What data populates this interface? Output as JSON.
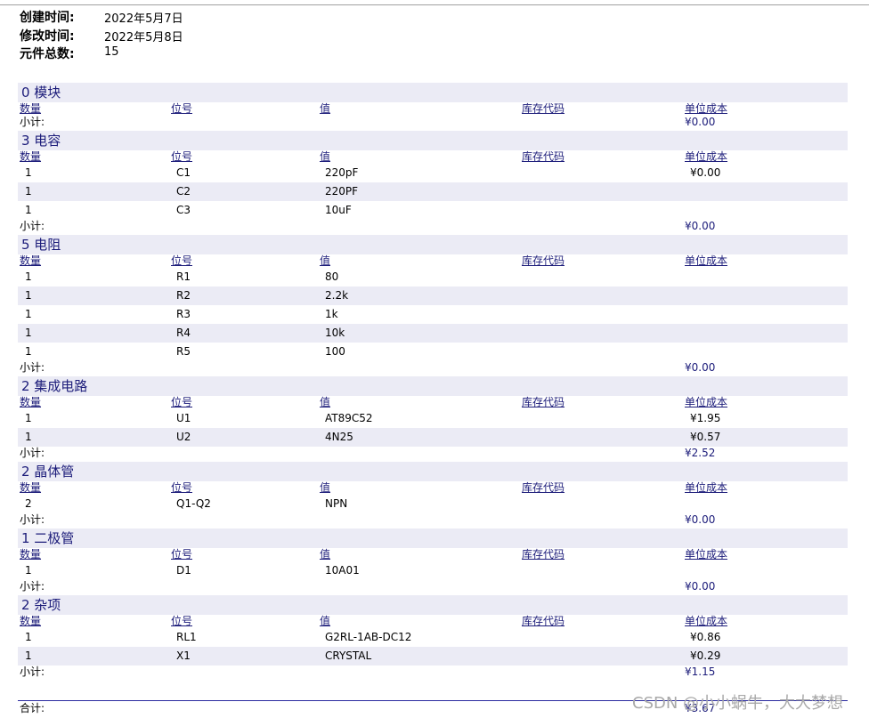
{
  "header": {
    "created_label": "创建时间:",
    "created_value": "2022年5月7日",
    "modified_label": "修改时间:",
    "modified_value": "2022年5月8日",
    "count_label": "元件总数:",
    "count_value": "15"
  },
  "columns": [
    "数量",
    "位号",
    "值",
    "库存代码",
    "单位成本"
  ],
  "subtotal_label": "小计:",
  "total_label": "合计:",
  "total_value": "¥3.67",
  "watermark": "CSDN @小小蜗牛，大大梦想",
  "categories": [
    {
      "title": "0 模块",
      "subtotal": "¥0.00",
      "items": []
    },
    {
      "title": "3 电容",
      "subtotal": "¥0.00",
      "items": [
        {
          "qty": "1",
          "ref": "C1",
          "value": "220pF",
          "code": "",
          "cost": "¥0.00"
        },
        {
          "qty": "1",
          "ref": "C2",
          "value": "220PF",
          "code": "",
          "cost": ""
        },
        {
          "qty": "1",
          "ref": "C3",
          "value": "10uF",
          "code": "",
          "cost": ""
        }
      ]
    },
    {
      "title": "5 电阻",
      "subtotal": "¥0.00",
      "items": [
        {
          "qty": "1",
          "ref": "R1",
          "value": "80",
          "code": "",
          "cost": ""
        },
        {
          "qty": "1",
          "ref": "R2",
          "value": "2.2k",
          "code": "",
          "cost": ""
        },
        {
          "qty": "1",
          "ref": "R3",
          "value": "1k",
          "code": "",
          "cost": ""
        },
        {
          "qty": "1",
          "ref": "R4",
          "value": "10k",
          "code": "",
          "cost": ""
        },
        {
          "qty": "1",
          "ref": "R5",
          "value": "100",
          "code": "",
          "cost": ""
        }
      ]
    },
    {
      "title": "2 集成电路",
      "subtotal": "¥2.52",
      "items": [
        {
          "qty": "1",
          "ref": "U1",
          "value": "AT89C52",
          "code": "",
          "cost": "¥1.95"
        },
        {
          "qty": "1",
          "ref": "U2",
          "value": "4N25",
          "code": "",
          "cost": "¥0.57"
        }
      ]
    },
    {
      "title": "2 晶体管",
      "subtotal": "¥0.00",
      "items": [
        {
          "qty": "2",
          "ref": "Q1-Q2",
          "value": "NPN",
          "code": "",
          "cost": ""
        }
      ]
    },
    {
      "title": "1 二极管",
      "subtotal": "¥0.00",
      "items": [
        {
          "qty": "1",
          "ref": "D1",
          "value": "10A01",
          "code": "",
          "cost": ""
        }
      ]
    },
    {
      "title": "2 杂项",
      "subtotal": "¥1.15",
      "items": [
        {
          "qty": "1",
          "ref": "RL1",
          "value": "G2RL-1AB-DC12",
          "code": "",
          "cost": "¥0.86"
        },
        {
          "qty": "1",
          "ref": "X1",
          "value": "CRYSTAL",
          "code": "",
          "cost": "¥0.29"
        }
      ]
    }
  ]
}
